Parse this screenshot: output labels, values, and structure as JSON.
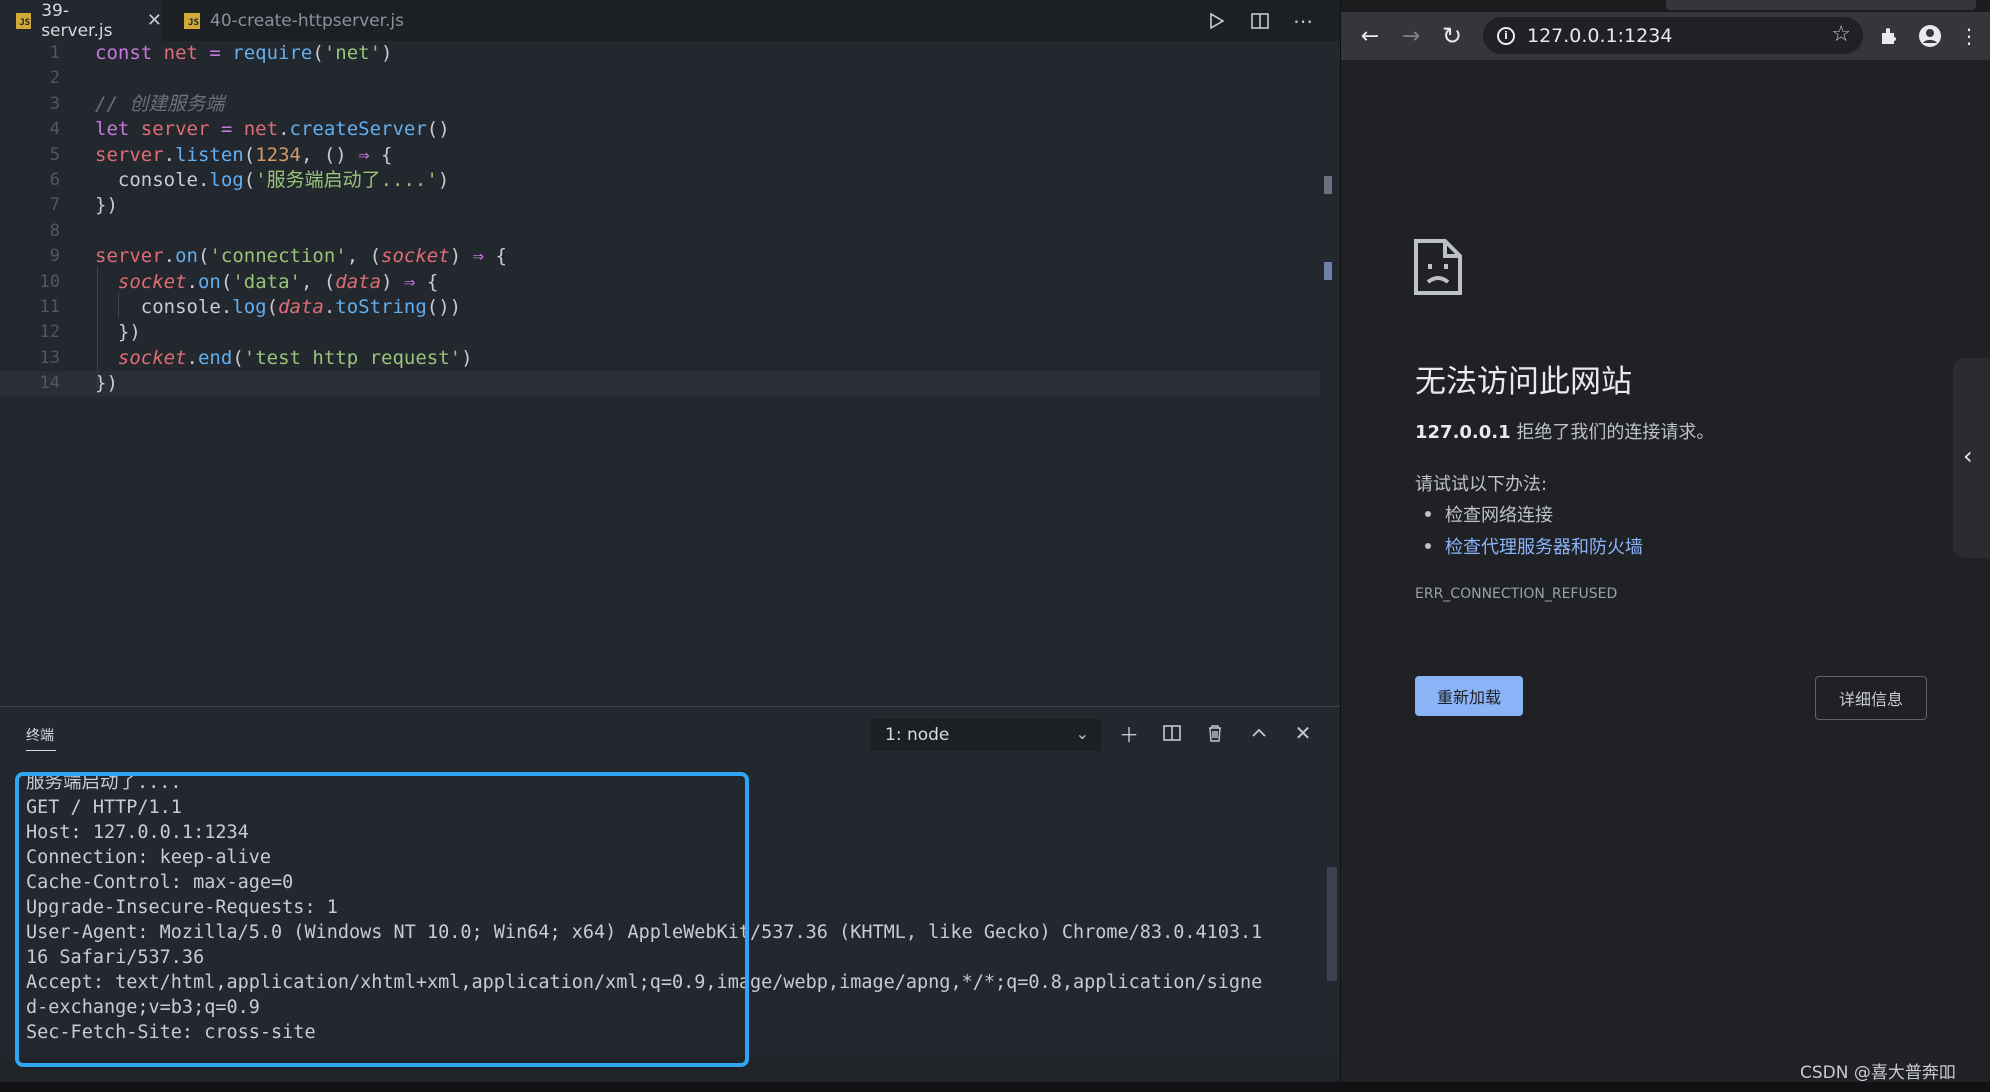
{
  "editor": {
    "tabs": [
      {
        "label": "39-server.js",
        "active": true,
        "badge": "JS"
      },
      {
        "label": "40-create-httpserver.js",
        "active": false,
        "badge": "JS"
      }
    ],
    "toolbar_icons": [
      "run-icon",
      "split-editor-icon",
      "more-icon"
    ],
    "lines": [
      {
        "n": "1",
        "tokens": [
          [
            "kw",
            "const "
          ],
          [
            "var",
            "net "
          ],
          [
            "op",
            "= "
          ],
          [
            "fn",
            "require"
          ],
          [
            "pun",
            "("
          ],
          [
            "str",
            "'net'"
          ],
          [
            "pun",
            ")"
          ]
        ]
      },
      {
        "n": "2",
        "tokens": []
      },
      {
        "n": "3",
        "tokens": [
          [
            "cm",
            "// 创建服务端"
          ]
        ]
      },
      {
        "n": "4",
        "tokens": [
          [
            "kw",
            "let "
          ],
          [
            "var",
            "server "
          ],
          [
            "op",
            "= "
          ],
          [
            "var",
            "net"
          ],
          [
            "pun",
            "."
          ],
          [
            "fn",
            "createServer"
          ],
          [
            "pun",
            "()"
          ]
        ]
      },
      {
        "n": "5",
        "tokens": [
          [
            "var",
            "server"
          ],
          [
            "pun",
            "."
          ],
          [
            "fn",
            "listen"
          ],
          [
            "pun",
            "("
          ],
          [
            "num",
            "1234"
          ],
          [
            "pun",
            ", () "
          ],
          [
            "op",
            "⇒ "
          ],
          [
            "pun",
            "{"
          ]
        ]
      },
      {
        "n": "6",
        "tokens": [
          [
            "pun",
            "  console."
          ],
          [
            "fn",
            "log"
          ],
          [
            "pun",
            "("
          ],
          [
            "str",
            "'服务端启动了....'"
          ],
          [
            "pun",
            ")"
          ]
        ]
      },
      {
        "n": "7",
        "tokens": [
          [
            "pun",
            "})"
          ]
        ]
      },
      {
        "n": "8",
        "tokens": []
      },
      {
        "n": "9",
        "tokens": [
          [
            "var",
            "server"
          ],
          [
            "pun",
            "."
          ],
          [
            "fn",
            "on"
          ],
          [
            "pun",
            "("
          ],
          [
            "str",
            "'connection'"
          ],
          [
            "pun",
            ", ("
          ],
          [
            "par",
            "socket"
          ],
          [
            "pun",
            ") "
          ],
          [
            "op",
            "⇒ "
          ],
          [
            "pun",
            "{"
          ]
        ]
      },
      {
        "n": "10",
        "tokens": [
          [
            "pun",
            "  "
          ],
          [
            "par",
            "socket"
          ],
          [
            "pun",
            "."
          ],
          [
            "fn",
            "on"
          ],
          [
            "pun",
            "("
          ],
          [
            "str",
            "'data'"
          ],
          [
            "pun",
            ", ("
          ],
          [
            "par",
            "data"
          ],
          [
            "pun",
            ") "
          ],
          [
            "op",
            "⇒ "
          ],
          [
            "pun",
            "{"
          ]
        ]
      },
      {
        "n": "11",
        "tokens": [
          [
            "pun",
            "    console."
          ],
          [
            "fn",
            "log"
          ],
          [
            "pun",
            "("
          ],
          [
            "par",
            "data"
          ],
          [
            "pun",
            "."
          ],
          [
            "fn",
            "toString"
          ],
          [
            "pun",
            "())"
          ]
        ]
      },
      {
        "n": "12",
        "tokens": [
          [
            "pun",
            "  })"
          ]
        ]
      },
      {
        "n": "13",
        "tokens": [
          [
            "pun",
            "  "
          ],
          [
            "par",
            "socket"
          ],
          [
            "pun",
            "."
          ],
          [
            "fn",
            "end"
          ],
          [
            "pun",
            "("
          ],
          [
            "str",
            "'test http request'"
          ],
          [
            "pun",
            ")"
          ]
        ]
      },
      {
        "n": "14",
        "tokens": [
          [
            "pun",
            "})"
          ]
        ]
      }
    ]
  },
  "panel": {
    "title": "终端",
    "terminal_select": "1: node",
    "icons": [
      "add-terminal-icon",
      "split-terminal-icon",
      "trash-icon",
      "maximize-panel-icon",
      "close-panel-icon"
    ],
    "output": [
      "服务端启动了....",
      "GET / HTTP/1.1",
      "Host: 127.0.0.1:1234",
      "Connection: keep-alive",
      "Cache-Control: max-age=0",
      "Upgrade-Insecure-Requests: 1",
      "User-Agent: Mozilla/5.0 (Windows NT 10.0; Win64; x64) AppleWebKit/537.36 (KHTML, like Gecko) Chrome/83.0.4103.1",
      "16 Safari/537.36",
      "Accept: text/html,application/xhtml+xml,application/xml;q=0.9,image/webp,image/apng,*/*;q=0.8,application/signe",
      "d-exchange;v=b3;q=0.9",
      "Sec-Fetch-Site: cross-site"
    ],
    "highlight_color": "#2ea6f2"
  },
  "browser": {
    "url": "127.0.0.1:1234",
    "error": {
      "title": "无法访问此网站",
      "host": "127.0.0.1",
      "desc_rest": " 拒绝了我们的连接请求。",
      "try_label": "请试试以下办法:",
      "suggestions": [
        {
          "text": "检查网络连接",
          "link": false
        },
        {
          "text": "检查代理服务器和防火墙",
          "link": true
        }
      ],
      "code": "ERR_CONNECTION_REFUSED",
      "reload_label": "重新加载",
      "details_label": "详细信息"
    },
    "accent_color": "#8ab4f8"
  },
  "watermark": "CSDN @喜大普奔吅"
}
